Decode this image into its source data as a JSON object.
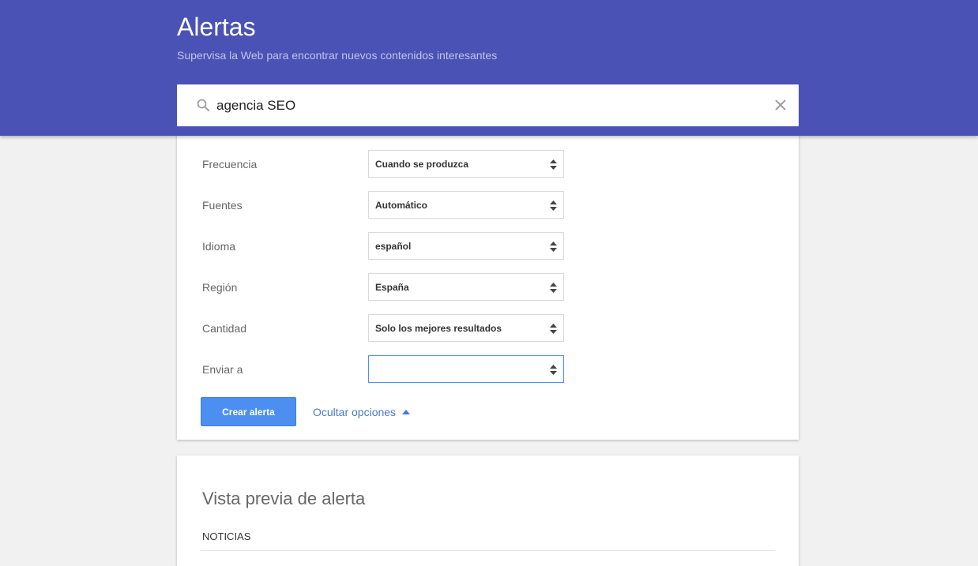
{
  "header": {
    "title": "Alertas",
    "subtitle": "Supervisa la Web para encontrar nuevos contenidos interesantes",
    "background_color": "#4a52b6"
  },
  "search": {
    "value": "agencia SEO",
    "search_icon": "search-icon",
    "clear_icon": "close-icon"
  },
  "options": {
    "rows": [
      {
        "label": "Frecuencia",
        "value": "Cuando se produzca"
      },
      {
        "label": "Fuentes",
        "value": "Automático"
      },
      {
        "label": "Idioma",
        "value": "español"
      },
      {
        "label": "Región",
        "value": "España"
      },
      {
        "label": "Cantidad",
        "value": "Solo los mejores resultados"
      },
      {
        "label": "Enviar a",
        "value": ""
      }
    ],
    "select_icon": "updown-arrows-icon",
    "create_button": "Crear alerta",
    "hide_options_link": "Ocultar opciones",
    "button_color": "#4d8ff0",
    "link_color": "#4a78d6"
  },
  "preview": {
    "title": "Vista previa de alerta",
    "section": "NOTICIAS"
  }
}
